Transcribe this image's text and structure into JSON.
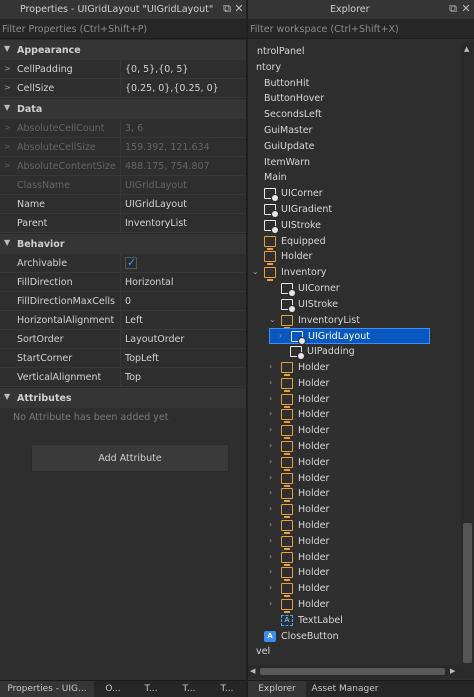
{
  "properties": {
    "title": "Properties - UIGridLayout \"UIGridLayout\"",
    "filter_placeholder": "Filter Properties (Ctrl+Shift+P)",
    "sections": {
      "appearance": "Appearance",
      "data": "Data",
      "behavior": "Behavior",
      "attributes": "Attributes"
    },
    "appearance": [
      {
        "name": "CellPadding",
        "value": "{0, 5},{0, 5}"
      },
      {
        "name": "CellSize",
        "value": "{0.25, 0},{0.25, 0}"
      }
    ],
    "data": [
      {
        "name": "AbsoluteCellCount",
        "value": "3, 6"
      },
      {
        "name": "AbsoluteCellSize",
        "value": "159.392, 121.634"
      },
      {
        "name": "AbsoluteContentSize",
        "value": "488.175, 754.807"
      },
      {
        "name": "ClassName",
        "value": "UIGridLayout"
      },
      {
        "name": "Name",
        "value": "UIGridLayout"
      },
      {
        "name": "Parent",
        "value": "InventoryList"
      }
    ],
    "behavior": [
      {
        "name": "Archivable",
        "value": ""
      },
      {
        "name": "FillDirection",
        "value": "Horizontal"
      },
      {
        "name": "FillDirectionMaxCells",
        "value": "0"
      },
      {
        "name": "HorizontalAlignment",
        "value": "Left"
      },
      {
        "name": "SortOrder",
        "value": "LayoutOrder"
      },
      {
        "name": "StartCorner",
        "value": "TopLeft"
      },
      {
        "name": "VerticalAlignment",
        "value": "Top"
      }
    ],
    "no_attributes": "No Attribute has been added yet",
    "add_attribute": "Add Attribute"
  },
  "explorer": {
    "title": "Explorer",
    "filter_placeholder": "Filter workspace (Ctrl+Shift+X)",
    "items": [
      {
        "label": "ntrolPanel",
        "icon": "none"
      },
      {
        "label": "ntory",
        "icon": "none"
      },
      {
        "label": "ButtonHit",
        "icon": "none"
      },
      {
        "label": "ButtonHover",
        "icon": "none"
      },
      {
        "label": "SecondsLeft",
        "icon": "none"
      },
      {
        "label": "GuiMaster",
        "icon": "none"
      },
      {
        "label": "GuiUpdate",
        "icon": "none"
      },
      {
        "label": "ItemWarn",
        "icon": "none"
      },
      {
        "label": "Main",
        "icon": "none"
      },
      {
        "label": "UICorner",
        "icon": "ui-modifier-icon"
      },
      {
        "label": "UIGradient",
        "icon": "ui-modifier-icon"
      },
      {
        "label": "UIStroke",
        "icon": "ui-modifier-icon"
      },
      {
        "label": "Equipped",
        "icon": "frame-icon"
      },
      {
        "label": "Holder",
        "icon": "frame-icon"
      },
      {
        "label": "Inventory",
        "icon": "frame-icon"
      },
      {
        "label": "UICorner",
        "icon": "ui-modifier-icon"
      },
      {
        "label": "UIStroke",
        "icon": "ui-modifier-icon"
      },
      {
        "label": "InventoryList",
        "icon": "frame-icon"
      },
      {
        "label": "UIGridLayout",
        "icon": "ui-modifier-icon"
      },
      {
        "label": "UIPadding",
        "icon": "ui-modifier-icon"
      },
      {
        "label": "Holder",
        "icon": "frame-icon"
      },
      {
        "label": "Holder",
        "icon": "frame-icon"
      },
      {
        "label": "Holder",
        "icon": "frame-icon"
      },
      {
        "label": "Holder",
        "icon": "frame-icon"
      },
      {
        "label": "Holder",
        "icon": "frame-icon"
      },
      {
        "label": "Holder",
        "icon": "frame-icon"
      },
      {
        "label": "Holder",
        "icon": "frame-icon"
      },
      {
        "label": "Holder",
        "icon": "frame-icon"
      },
      {
        "label": "Holder",
        "icon": "frame-icon"
      },
      {
        "label": "Holder",
        "icon": "frame-icon"
      },
      {
        "label": "Holder",
        "icon": "frame-icon"
      },
      {
        "label": "Holder",
        "icon": "frame-icon"
      },
      {
        "label": "Holder",
        "icon": "frame-icon"
      },
      {
        "label": "Holder",
        "icon": "frame-icon"
      },
      {
        "label": "Holder",
        "icon": "frame-icon"
      },
      {
        "label": "Holder",
        "icon": "frame-icon"
      },
      {
        "label": "TextLabel",
        "icon": "text-label-icon"
      },
      {
        "label": "CloseButton",
        "icon": "button-icon"
      },
      {
        "label": "vel",
        "icon": "none"
      }
    ],
    "selected_label": "UIGridLayout"
  },
  "bottom_tabs": {
    "left": [
      "Properties - UIG...",
      "O...",
      "T...",
      "T...",
      "T..."
    ],
    "right": [
      "Explorer",
      "Asset Manager"
    ]
  },
  "colors": {
    "selection": "#0a58bf",
    "frame_icon": "#e6a03c",
    "checkbox_tick": "#3a97ff"
  }
}
